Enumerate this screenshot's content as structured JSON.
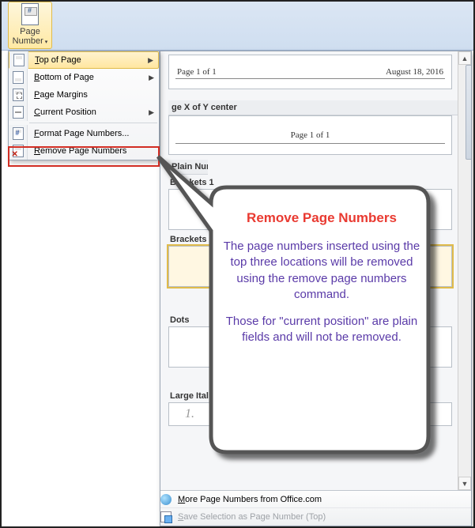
{
  "ribbon": {
    "page_number_label_line1": "Page",
    "page_number_label_line2": "Number"
  },
  "menu": {
    "items": [
      {
        "label": "Top of Page",
        "has_submenu": true,
        "highlight": true,
        "icon": "doc-top-icon"
      },
      {
        "label": "Bottom of Page",
        "has_submenu": true,
        "highlight": false,
        "icon": "doc-bottom-icon"
      },
      {
        "label": "Page Margins",
        "has_submenu": false,
        "highlight": false,
        "icon": "doc-margins-icon"
      },
      {
        "label": "Current Position",
        "has_submenu": true,
        "highlight": false,
        "icon": "doc-current-icon"
      },
      {
        "label": "Format Page Numbers...",
        "has_submenu": false,
        "highlight": false,
        "icon": "format-page-numbers-icon"
      },
      {
        "label": "Remove Page Numbers",
        "has_submenu": false,
        "highlight": false,
        "icon": "remove-page-numbers-icon"
      }
    ],
    "accel_positions": [
      0,
      0,
      7,
      0,
      0,
      0
    ]
  },
  "gallery": {
    "groups": [
      {
        "header": "",
        "items": [
          {
            "name": "",
            "preview": {
              "left": "Page 1 of 1",
              "right": "August 18, 2016",
              "rule": true
            }
          }
        ]
      },
      {
        "header": "ge X of Y center",
        "items": [
          {
            "name": "",
            "preview": {
              "center": "Page 1 of 1",
              "rule": true
            }
          }
        ]
      },
      {
        "header": "Plain Number",
        "items": [
          {
            "name": "Brackets 1",
            "preview": {
              "center": ""
            }
          },
          {
            "name": "Brackets 2",
            "preview": {
              "center": "",
              "highlight": true
            }
          },
          {
            "name": "Dots",
            "preview": {
              "center": ""
            }
          },
          {
            "name": "Large Italics 1",
            "preview": {
              "center": "1.",
              "italics": true
            }
          }
        ]
      }
    ],
    "footer": {
      "more": "More Page Numbers from Office.com",
      "save": "Save Selection as Page Number (Top)"
    }
  },
  "callout": {
    "title": "Remove Page Numbers",
    "p1": "The page numbers inserted using the top three locations will be removed using the remove page numbers command.",
    "p2": "Those for \"current position\" are plain fields and will not be removed."
  }
}
